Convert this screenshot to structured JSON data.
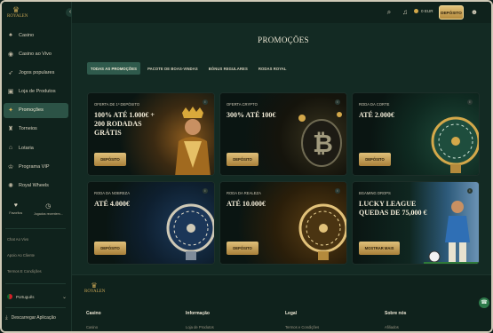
{
  "sidebar": {
    "logo": "ROYALEN",
    "items": [
      {
        "label": "Casino",
        "icon": "cards-icon"
      },
      {
        "label": "Casino ao Vivo",
        "icon": "live-icon"
      },
      {
        "label": "Jogos populares",
        "icon": "rocket-icon"
      },
      {
        "label": "Loja de Produtos",
        "icon": "shop-icon"
      },
      {
        "label": "Promoções",
        "icon": "gift-icon"
      },
      {
        "label": "Torneios",
        "icon": "trophy-icon"
      },
      {
        "label": "Lotaria",
        "icon": "lottery-icon"
      },
      {
        "label": "Programa VIP",
        "icon": "crown-icon"
      },
      {
        "label": "Royal Wheels",
        "icon": "wheel-icon"
      }
    ],
    "favorites_label": "Favoritos",
    "recent_label": "Jogados recentem...",
    "links": [
      "Chat Ao Vivo",
      "Apoio Ao Cliente",
      "Termos E Condições"
    ],
    "language": "Português",
    "download": "Descarregar Aplicação"
  },
  "topbar": {
    "balance": "0 EUR",
    "deposit_label": "DEPÓSITO"
  },
  "main": {
    "title": "PROMOÇÕES",
    "tabs": [
      "TODAS AS PROMOÇÕES",
      "PACOTE DE BOAS-VINDAS",
      "BÓNUS REGULARES",
      "RODAS ROYAL"
    ],
    "cards": [
      {
        "tag": "OFERTA DE 1º DEPÓSITO",
        "title": "100% ATÉ 1.000€ + 200 RODADAS GRÁTIS",
        "button": "DEPÓSITO"
      },
      {
        "tag": "OFERTA CRYPTO",
        "title": "300% ATÉ 100€",
        "button": "DEPÓSITO"
      },
      {
        "tag": "RODA DA CORTE",
        "title": "ATÉ 2.000€",
        "button": "DEPÓSITO"
      },
      {
        "tag": "RODA DA NOBREZA",
        "title": "ATÉ 4.000€",
        "button": "DEPÓSITO"
      },
      {
        "tag": "RODA DA REALEZA",
        "title": "ATÉ 10.000€",
        "button": "DEPÓSITO"
      },
      {
        "tag": "BGAMING DROPS",
        "title": "LUCKY LEAGUE QUEDAS DE 75,000 €",
        "button": "MOSTRAR MAIS"
      }
    ]
  },
  "footer": {
    "logo": "ROYALEN",
    "columns": [
      {
        "heading": "Casino",
        "link": "Casino"
      },
      {
        "heading": "Informação",
        "link": "Loja de Produtos"
      },
      {
        "heading": "Legal",
        "link": "Termos e Condições"
      },
      {
        "heading": "Sobre nós",
        "link": "Afiliados"
      }
    ]
  },
  "colors": {
    "accent_gold": "#d4a84a",
    "bg": "#132a23",
    "active": "#2c5346"
  }
}
